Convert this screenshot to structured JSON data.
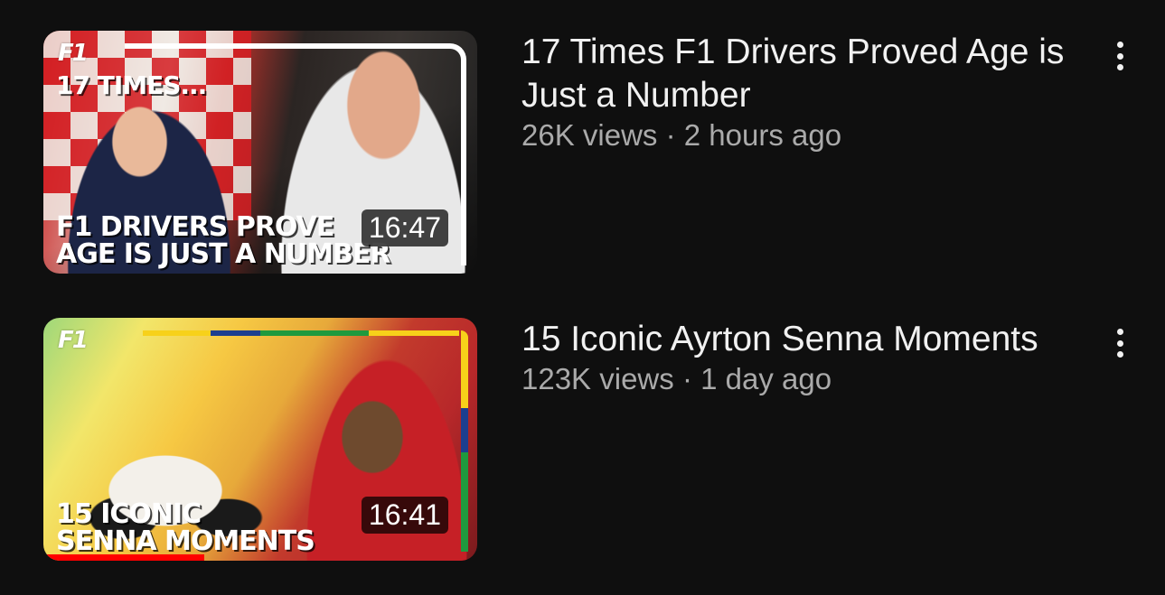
{
  "videos": [
    {
      "thumbnail": {
        "logo_text": "F1",
        "top_caption": "17 TIMES...",
        "caption_line1": "F1 DRIVERS PROVE",
        "caption_line2": "AGE IS JUST A NUMBER",
        "duration": "16:47"
      },
      "title": "17 Times F1 Drivers Proved Age is Just a Number",
      "views": "26K views",
      "separator": "·",
      "age": "2 hours ago",
      "menu_icon": "more-vertical-icon"
    },
    {
      "thumbnail": {
        "logo_text": "F1",
        "caption_line1": "15 ICONIC",
        "caption_line2": "SENNA MOMENTS",
        "duration": "16:41",
        "watch_progress": 0.37
      },
      "title": "15 Iconic Ayrton Senna Moments",
      "views": "123K views",
      "separator": "·",
      "age": "1 day ago",
      "menu_icon": "more-vertical-icon"
    }
  ],
  "colors": {
    "background": "#0f0f0f",
    "title": "#f1f1f1",
    "meta": "#aaaaaa",
    "progress": "#ff0000"
  }
}
